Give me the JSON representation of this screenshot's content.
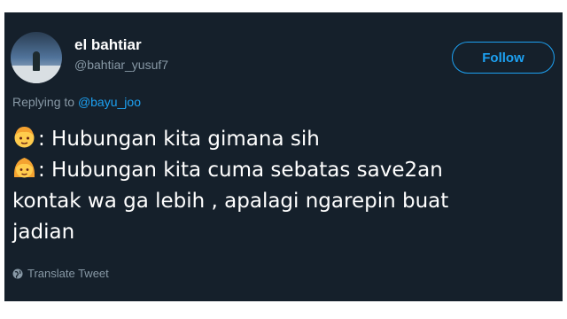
{
  "author": {
    "display_name": "el bahtiar",
    "handle": "@bahtiar_yusuf7"
  },
  "follow_button": {
    "label": "Follow"
  },
  "replying": {
    "prefix": "Replying to",
    "mention": "@bayu_joo"
  },
  "tweet": {
    "lines": [
      {
        "emoji": "boy-emoji",
        "text": ": Hubungan kita gimana sih"
      },
      {
        "emoji": "girl-emoji",
        "text": ": Hubungan kita cuma sebatas save2an"
      },
      {
        "text": "kontak wa ga lebih , apalagi ngarepin buat"
      },
      {
        "text": "jadian"
      }
    ]
  },
  "translate": {
    "label": "Translate Tweet",
    "icon": "globe-icon"
  },
  "colors": {
    "background": "#15202b",
    "accent": "#1da1f2",
    "secondary_text": "#8899a6",
    "primary_text": "#ffffff",
    "emoji_skin": "#ffcc4d",
    "emoji_hair": "#f4a230"
  }
}
